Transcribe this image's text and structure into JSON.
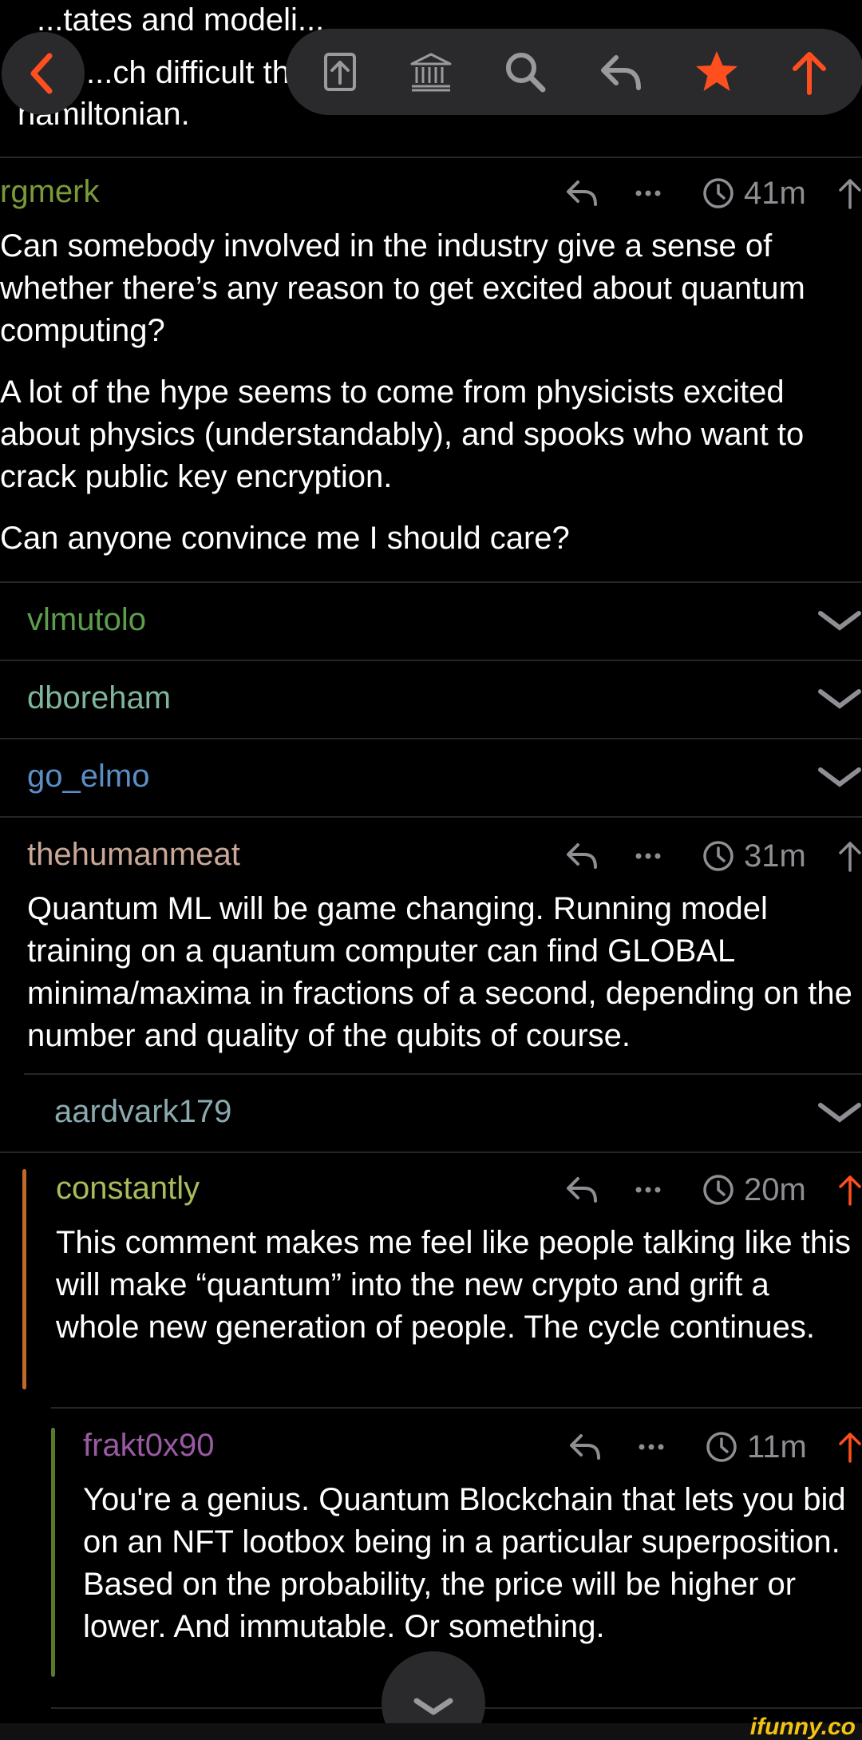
{
  "top": {
    "lines": [
      "...tates and modeli...",
      "...ch difficult th",
      "hamiltonian."
    ]
  },
  "toolbar": {
    "icons": [
      "back-icon",
      "share-icon",
      "institution-icon",
      "search-icon",
      "reply-icon",
      "star-icon",
      "upvote-icon"
    ]
  },
  "comments": [
    {
      "author": "rgmerk",
      "author_color": "#7a9a3a",
      "time": "41m",
      "body": [
        "Can somebody involved in the industry give a sense of whether there’s any reason to get excited about quantum computing?",
        "A lot of the hype seems to come from physicists excited about physics (understandably), and spooks who want to crack public key encryption.",
        "Can anyone convince me I should care?"
      ]
    },
    {
      "author": "thehumanmeat",
      "author_color": "#c9a897",
      "time": "31m",
      "body": [
        "Quantum ML will be game changing. Running model training on a quantum computer can find GLOBAL minima/maxima in fractions of a second, depending on the number and quality of the qubits of course."
      ]
    },
    {
      "author": "constantly",
      "author_color": "#a7bc5b",
      "time": "20m",
      "body": [
        "This comment makes me feel like people talking like this will make “quantum” into the new crypto and grift a whole new generation of people. The cycle continues."
      ]
    },
    {
      "author": "frakt0x90",
      "author_color": "#9a5aa3",
      "time": "11m",
      "body": [
        "You're a genius. Quantum Blockchain that lets you bid on an NFT lootbox being in a particular superposition. Based on the probability, the price will be higher or lower. And immutable. Or something."
      ]
    }
  ],
  "collapsed": [
    {
      "author": "vlmutolo",
      "color": "#5d9e4b"
    },
    {
      "author": "dboreham",
      "color": "#7fb59b"
    },
    {
      "author": "go_elmo",
      "color": "#5a8fc6"
    },
    {
      "author": "aardvark179",
      "color": "#8aaab0"
    }
  ],
  "colors": {
    "accent": "#ff4f1f",
    "thread_orange": "#c06a2a",
    "thread_green": "#5a7a2a"
  },
  "watermark": "ifunny.co"
}
